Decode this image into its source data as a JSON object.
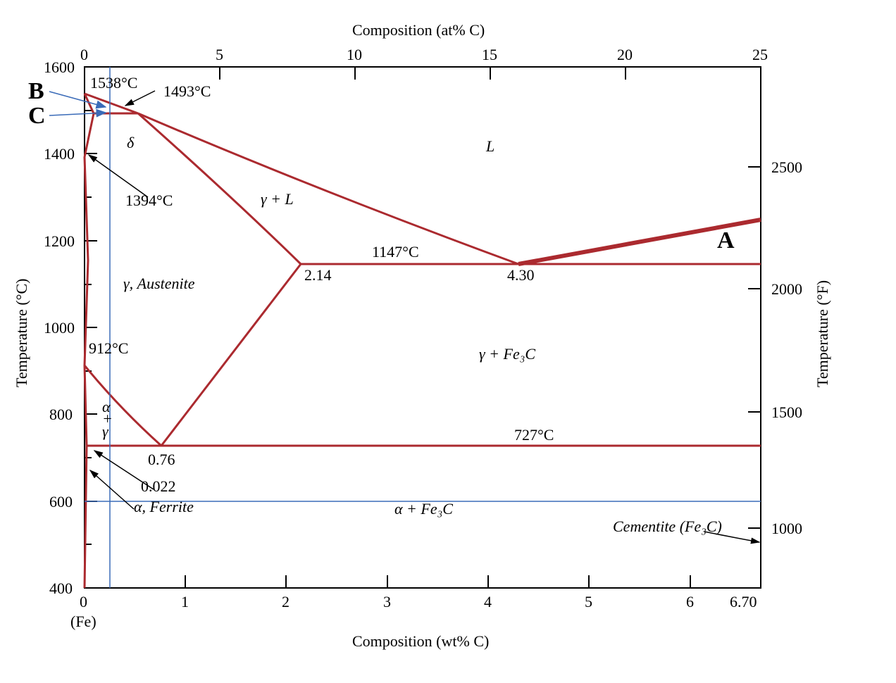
{
  "chart_data": {
    "type": "phase-diagram",
    "title_top": "Composition (at% C)",
    "title_bottom": "Composition (wt% C)",
    "title_left": "Temperature (°C)",
    "title_right": "Temperature (°F)",
    "x_bottom": {
      "min": 0,
      "max": 6.7,
      "ticks": [
        "0",
        "1",
        "2",
        "3",
        "4",
        "5",
        "6",
        "6.70"
      ]
    },
    "x_top": {
      "ticks": [
        "0",
        "5",
        "10",
        "15",
        "20",
        "25"
      ]
    },
    "y_left": {
      "min": 400,
      "max": 1600,
      "ticks": [
        "400",
        "600",
        "800",
        "1000",
        "1200",
        "1400",
        "1600"
      ]
    },
    "y_right": {
      "ticks": [
        "1000",
        "1500",
        "2000",
        "2500"
      ]
    },
    "regions": {
      "L": "L",
      "delta": "δ",
      "gamma_plus_L": "γ + L",
      "gamma": "γ, Austenite",
      "gamma_plus_Fe3C": "γ + Fe₃C",
      "alpha": "α, Ferrite",
      "alpha_plus_gamma": "α + γ",
      "alpha_plus_Fe3C": "α + Fe₃C",
      "cementite": "Cementite (Fe₃C)"
    },
    "points": {
      "t1538": "1538°C",
      "t1493": "1493°C",
      "t1394": "1394°C",
      "t1147": "1147°C",
      "t912": "912°C",
      "t727": "727°C",
      "c214": "2.14",
      "c430": "4.30",
      "c076": "0.76",
      "c0022": "0.022",
      "fe": "(Fe)"
    },
    "annotations": {
      "A": "A",
      "B": "B",
      "C": "C"
    },
    "isothermals": [
      {
        "tempC": 1147,
        "x_from": 2.14,
        "x_to": 6.7,
        "type": "eutectic"
      },
      {
        "tempC": 727,
        "x_from": 0.022,
        "x_to": 6.7,
        "type": "eutectoid"
      },
      {
        "tempC": 1493,
        "x_from": 0.09,
        "x_to": 0.53,
        "type": "peritectic"
      }
    ],
    "blue_guides": {
      "vertical_x": 0.25,
      "horizontal_tempC": 600
    }
  }
}
